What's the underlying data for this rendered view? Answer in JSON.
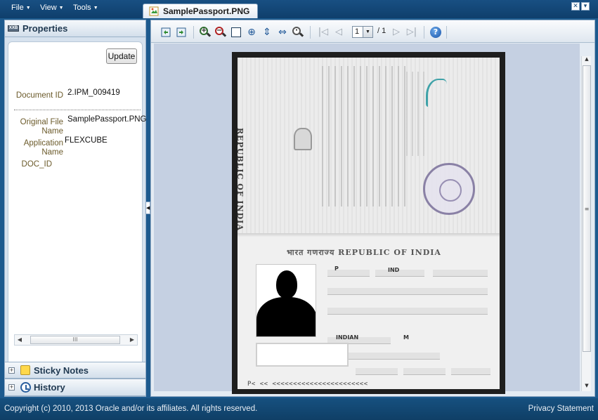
{
  "menubar": {
    "items": [
      {
        "label": "File"
      },
      {
        "label": "View"
      },
      {
        "label": "Tools"
      }
    ]
  },
  "tab": {
    "label": "SamplePassport.PNG"
  },
  "properties": {
    "title": "Properties",
    "update_label": "Update",
    "fields": [
      {
        "label": "Document ID",
        "value": "2.IPM_009419"
      },
      {
        "label": "Original File Name",
        "value": "SamplePassport.PNG"
      },
      {
        "label": "Application Name",
        "value": "FLEXCUBE"
      },
      {
        "label": "DOC_ID",
        "value": ""
      }
    ]
  },
  "sections": {
    "sticky_notes": "Sticky Notes",
    "history": "History"
  },
  "toolbar": {
    "page_current": "1",
    "page_of": "/ 1"
  },
  "passport_image": {
    "title_vertical": "REPUBLIC OF INDIA",
    "title_horizontal": "भारत गणराज्य  REPUBLIC OF INDIA",
    "type_value": "P",
    "country_value": "IND",
    "nationality_value": "INDIAN",
    "sex_value": "M",
    "mrz_line": "P<          <<   <<<<<<<<<<<<<<<<<<<<<<<"
  },
  "footer": {
    "copyright": "Copyright (c) 2010, 2013 Oracle and/or its affiliates. All rights reserved.",
    "privacy": "Privacy Statement"
  },
  "colors": {
    "chrome": "#1d5a8e",
    "panel": "#d6e2ee",
    "canvas": "#c5d0e2",
    "label": "#6b5a2a"
  }
}
